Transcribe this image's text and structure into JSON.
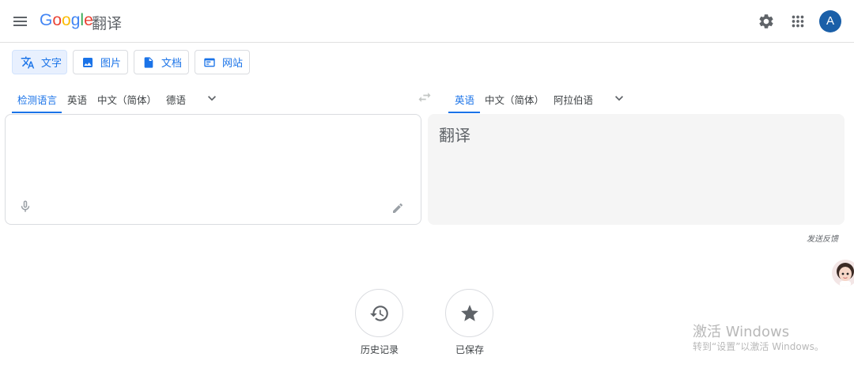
{
  "header": {
    "logo_letters": [
      "G",
      "o",
      "o",
      "g",
      "l",
      "e"
    ],
    "product": "翻译",
    "avatar_initial": "A",
    "icons": [
      "menu-icon",
      "settings-gear-icon",
      "apps-grid-icon"
    ]
  },
  "mode_tabs": [
    {
      "label": "文字",
      "icon": "text-translate-icon",
      "active": true
    },
    {
      "label": "图片",
      "icon": "image-icon",
      "active": false
    },
    {
      "label": "文档",
      "icon": "document-icon",
      "active": false
    },
    {
      "label": "网站",
      "icon": "website-icon",
      "active": false
    }
  ],
  "source_langs": [
    {
      "label": "检测语言",
      "selected": true
    },
    {
      "label": "英语",
      "selected": false
    },
    {
      "label": "中文（简体）",
      "selected": false
    },
    {
      "label": "德语",
      "selected": false
    }
  ],
  "target_langs": [
    {
      "label": "英语",
      "selected": true
    },
    {
      "label": "中文（简体）",
      "selected": false
    },
    {
      "label": "阿拉伯语",
      "selected": false
    }
  ],
  "source": {
    "value": ""
  },
  "target": {
    "placeholder": "翻译"
  },
  "feedback": "发送反馈",
  "actions": [
    {
      "label": "历史记录",
      "icon": "history-icon"
    },
    {
      "label": "已保存",
      "icon": "star-icon"
    }
  ],
  "watermark": {
    "title": "激活 Windows",
    "subtitle": "转到“设置”以激活 Windows。"
  },
  "colors": {
    "accent": "#1a73e8",
    "avatar": "#1a5fa8",
    "panel_bg": "#f5f5f5"
  }
}
